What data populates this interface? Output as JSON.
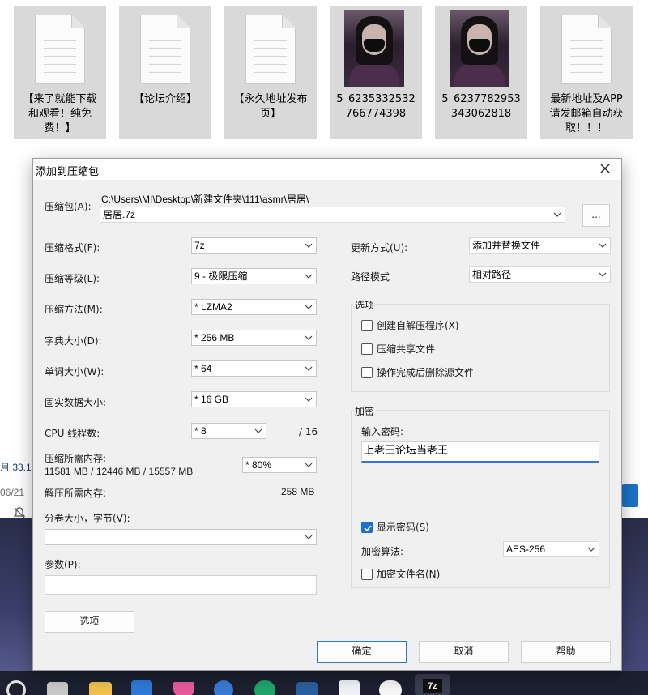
{
  "explorer": {
    "files": [
      {
        "name_lines": [
          "【来了就能下载",
          "和观看！纯免",
          "费！】"
        ],
        "kind": "doc-icon"
      },
      {
        "name_lines": [
          "【论坛介绍】"
        ],
        "kind": "doc-icon"
      },
      {
        "name_lines": [
          "【永久地址发布",
          "页】"
        ],
        "kind": "doc-icon"
      },
      {
        "name_lines": [
          "5_6235332532",
          "766774398"
        ],
        "kind": "photo-thumbnail"
      },
      {
        "name_lines": [
          "5_6237782953",
          "343062818"
        ],
        "kind": "photo-thumbnail"
      },
      {
        "name_lines": [
          "最新地址及APP",
          "请发邮箱自动获",
          "取！！！"
        ],
        "kind": "doc-icon"
      }
    ],
    "partial_left": {
      "line1": "月  33.1",
      "line2": "06/21"
    }
  },
  "dialog": {
    "title": "添加到压缩包",
    "close_icon": "close-icon",
    "archive_label": "压缩包(A):",
    "archive_path": "C:\\Users\\MI\\Desktop\\新建文件夹\\111\\asmr\\居居\\",
    "archive_name": "居居.7z",
    "browse_label": "...",
    "format_label": "压缩格式(F):",
    "format_value": "7z",
    "level_label": "压缩等级(L):",
    "level_value": "9 - 极限压缩",
    "method_label": "压缩方法(M):",
    "method_value": "*  LZMA2",
    "dict_label": "字典大小(D):",
    "dict_value": "*  256 MB",
    "word_label": "单词大小(W):",
    "word_value": "*  64",
    "solid_label": "固实数据大小:",
    "solid_value": "*  16 GB",
    "threads_label": "CPU 线程数:",
    "threads_value": "*  8",
    "threads_total": "/ 16",
    "mem_comp_label": "压缩所需内存:",
    "mem_comp_value": "11581 MB / 12446 MB / 15557 MB",
    "mem_percent": "*  80%",
    "mem_decomp_label": "解压所需内存:",
    "mem_decomp_value": "258 MB",
    "split_label": "分卷大小，字节(V):",
    "split_value": "",
    "params_label": "参数(P):",
    "params_value": "",
    "options_button": "选项",
    "update_label": "更新方式(U):",
    "update_value": "添加并替换文件",
    "pathmode_label": "路径模式",
    "pathmode_value": "相对路径",
    "options_group": {
      "title": "选项",
      "sfx": {
        "label": "创建自解压程序(X)",
        "checked": false
      },
      "shared": {
        "label": "压缩共享文件",
        "checked": false
      },
      "delete": {
        "label": "操作完成后删除源文件",
        "checked": false
      }
    },
    "encryption_group": {
      "title": "加密",
      "password_label": "输入密码:",
      "password_value": "上老王论坛当老王",
      "show_password": {
        "label": "显示密码(S)",
        "checked": true
      },
      "method_label": "加密算法:",
      "method_value": "AES-256",
      "encrypt_names": {
        "label": "加密文件名(N)",
        "checked": false
      }
    },
    "ok": "确定",
    "cancel": "取消",
    "help": "帮助"
  },
  "colors": {
    "accent": "#2f7ad6",
    "checked": "#1f6fd1",
    "dialog_bg": "#f0f0f0",
    "tile_bg": "#d9d9d9",
    "taskbar": "#1c2030"
  }
}
